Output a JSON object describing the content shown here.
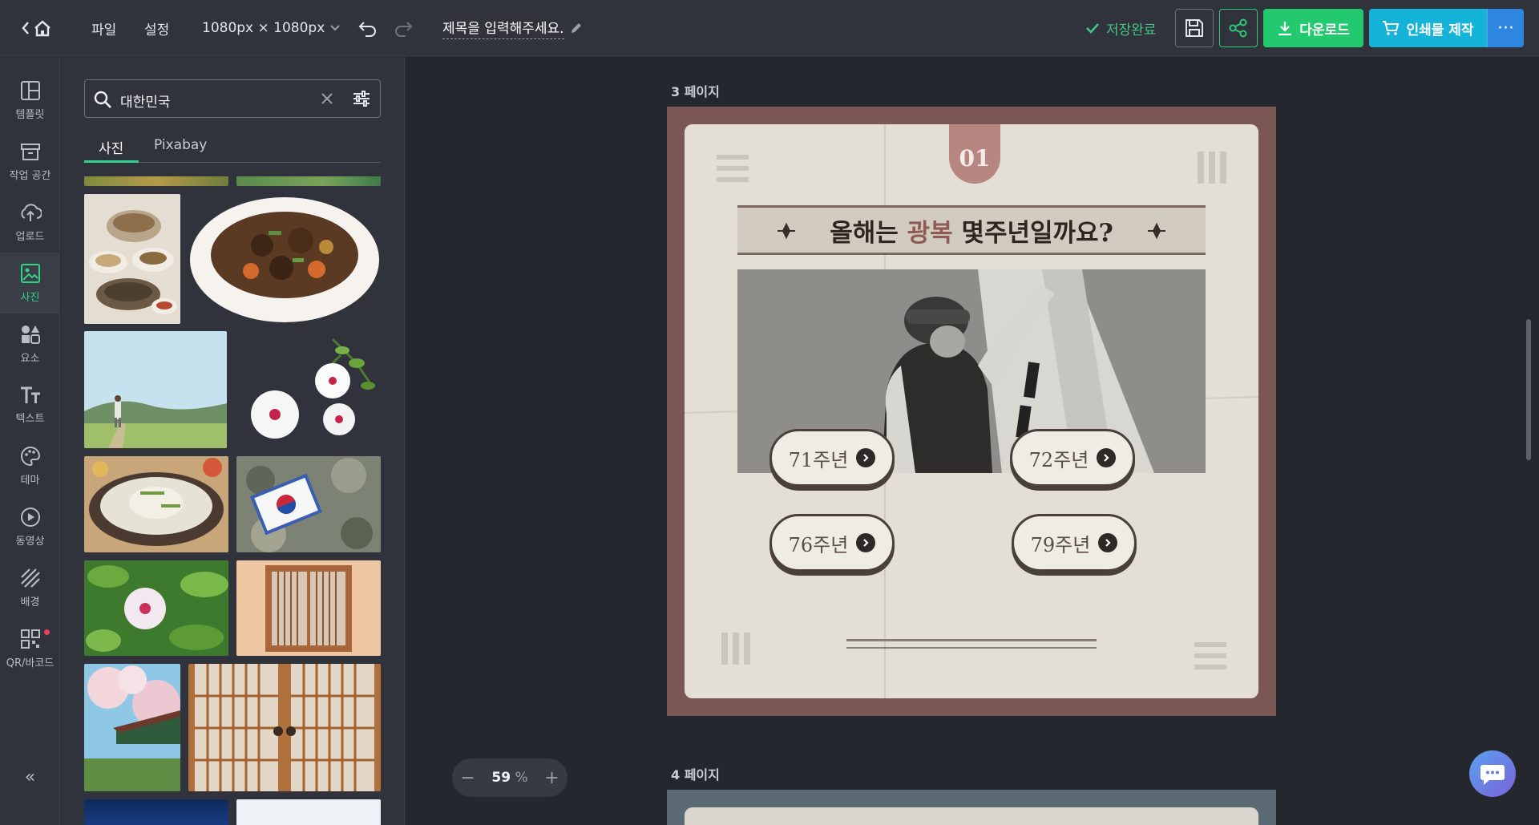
{
  "topbar": {
    "menu_file": "파일",
    "menu_settings": "설정",
    "canvas_size": "1080px × 1080px",
    "doc_title": "제목을 입력해주세요.",
    "save_status": "저장완료",
    "download_label": "다운로드",
    "print_label": "인쇄물 제작",
    "more_label": "···"
  },
  "rail": {
    "items": [
      {
        "label": "템플릿",
        "icon": "template-icon"
      },
      {
        "label": "작업 공간",
        "icon": "workspace-icon"
      },
      {
        "label": "업로드",
        "icon": "upload-icon"
      },
      {
        "label": "사진",
        "icon": "photo-icon"
      },
      {
        "label": "요소",
        "icon": "elements-icon"
      },
      {
        "label": "텍스트",
        "icon": "text-icon"
      },
      {
        "label": "테마",
        "icon": "palette-icon"
      },
      {
        "label": "동영상",
        "icon": "video-icon"
      },
      {
        "label": "배경",
        "icon": "background-icon"
      },
      {
        "label": "QR/바코드",
        "icon": "qr-icon"
      }
    ],
    "active": "사진",
    "collapse_label": "«"
  },
  "panel": {
    "search_value": "대한민국",
    "tabs": [
      "사진",
      "Pixabay"
    ],
    "active_tab": "사진"
  },
  "canvas": {
    "page3_label": "3 페이지",
    "page4_label": "4 페이지",
    "card": {
      "number": "01",
      "question_before": "올해는 ",
      "question_accent": "광복",
      "question_after": " 몇주년일까요?",
      "answers": [
        "71주년",
        "72주년",
        "76주년",
        "79주년"
      ]
    }
  },
  "zoom": {
    "minus": "−",
    "value": "59",
    "unit": "%",
    "plus": "+"
  },
  "colors": {
    "accent_green": "#22c96f",
    "accent_cyan": "#16b3d8",
    "accent_blue": "#2e86e0",
    "page_frame": "#7a5754",
    "number_tab": "#b78680"
  }
}
